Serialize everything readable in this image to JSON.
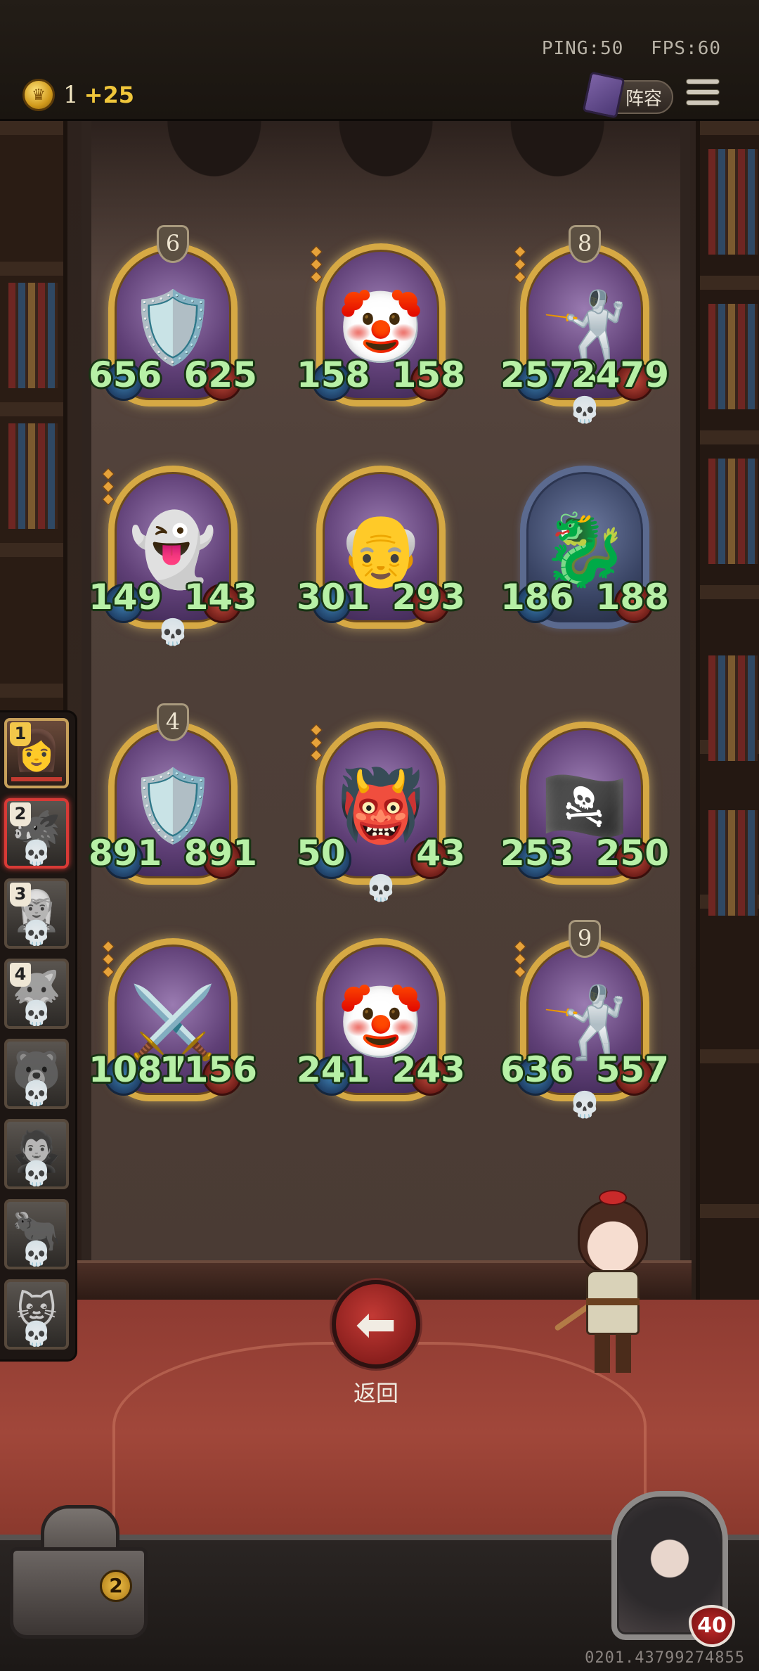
{
  "topbar": {
    "ping_label": "PING:50",
    "fps_label": "FPS:60",
    "coin_icon": "crown-coin-icon",
    "coin_count": "1",
    "coin_income": "+25",
    "lineup_label": "阵容",
    "menu_icon": "hamburger-menu-icon"
  },
  "board": {
    "cards": [
      {
        "level": "6",
        "atk": "656",
        "hp": "625",
        "portrait": "🛡️",
        "skull": false,
        "chain": false,
        "frame": "gold"
      },
      {
        "level": "",
        "atk": "158",
        "hp": "158",
        "portrait": "🤡",
        "skull": false,
        "chain": true,
        "frame": "gold"
      },
      {
        "level": "8",
        "atk": "2573",
        "hp": "2479",
        "portrait": "🤺",
        "skull": true,
        "chain": true,
        "frame": "gold"
      },
      {
        "level": "",
        "atk": "149",
        "hp": "143",
        "portrait": "👻",
        "skull": true,
        "chain": true,
        "frame": "gold"
      },
      {
        "level": "",
        "atk": "301",
        "hp": "293",
        "portrait": "👴",
        "skull": false,
        "chain": false,
        "frame": "gold"
      },
      {
        "level": "",
        "atk": "186",
        "hp": "188",
        "portrait": "🐉",
        "skull": false,
        "chain": false,
        "frame": "blue"
      },
      {
        "level": "4",
        "atk": "891",
        "hp": "891",
        "portrait": "🛡️",
        "skull": false,
        "chain": false,
        "frame": "gold"
      },
      {
        "level": "",
        "atk": "50",
        "hp": "43",
        "portrait": "👹",
        "skull": true,
        "chain": true,
        "frame": "gold"
      },
      {
        "level": "",
        "atk": "253",
        "hp": "250",
        "portrait": "🏴‍☠️",
        "skull": false,
        "chain": false,
        "frame": "gold"
      },
      {
        "level": "",
        "atk": "1087",
        "hp": "1156",
        "portrait": "⚔️",
        "skull": false,
        "chain": true,
        "frame": "gold"
      },
      {
        "level": "",
        "atk": "241",
        "hp": "243",
        "portrait": "🤡",
        "skull": false,
        "chain": false,
        "frame": "gold"
      },
      {
        "level": "9",
        "atk": "636",
        "hp": "557",
        "portrait": "🤺",
        "skull": true,
        "chain": true,
        "frame": "gold"
      }
    ]
  },
  "team": {
    "slots": [
      {
        "num": "1",
        "face": "👩",
        "state": "active",
        "skull": false
      },
      {
        "num": "2",
        "face": "🐗",
        "state": "selected",
        "skull": true
      },
      {
        "num": "3",
        "face": "🧝",
        "state": "dead",
        "skull": true
      },
      {
        "num": "4",
        "face": "🐺",
        "state": "dead",
        "skull": true
      },
      {
        "num": "",
        "face": "🐻",
        "state": "dead",
        "skull": true
      },
      {
        "num": "",
        "face": "🧛",
        "state": "dead",
        "skull": true
      },
      {
        "num": "",
        "face": "🐂",
        "state": "dead",
        "skull": true
      },
      {
        "num": "",
        "face": "🐱",
        "state": "dead",
        "skull": true
      }
    ]
  },
  "actions": {
    "back_icon": "back-arrow-icon",
    "back_label": "返回"
  },
  "bottom": {
    "chest_count": "2",
    "player_health": "40",
    "build_id": "0201.43799274855"
  },
  "colors": {
    "stat_green": "#b7f0a6",
    "gold_frame": "#d6a944",
    "back_red": "#a72b29"
  }
}
